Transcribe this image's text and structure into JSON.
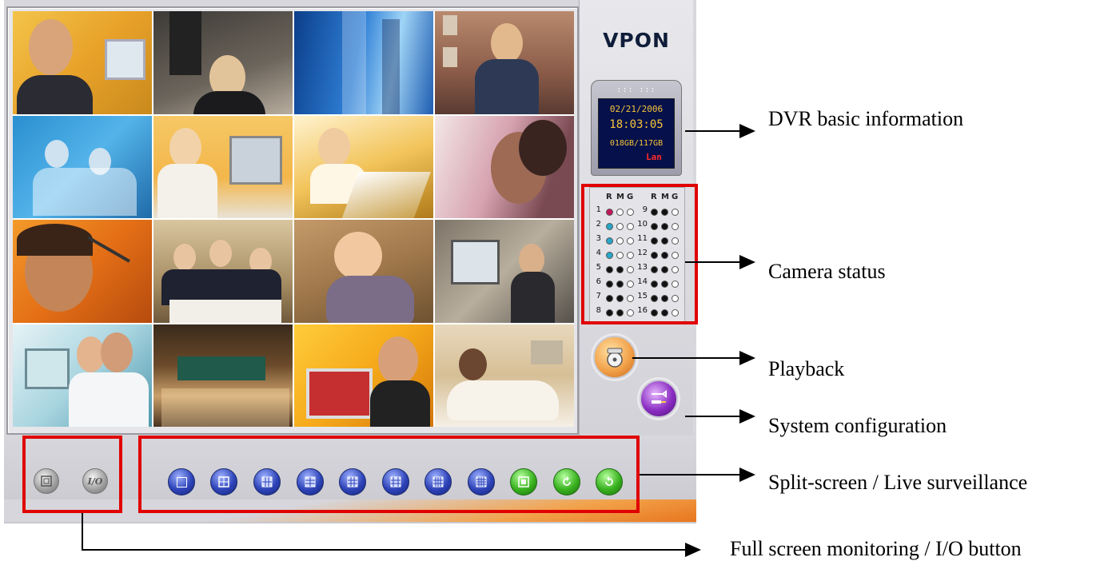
{
  "brand": {
    "logo": "VPON"
  },
  "dvr_info": {
    "top_dots": "::: :::",
    "date": "02/21/2006",
    "time": "18:03:05",
    "storage": "018GB/117GB",
    "connection": "Lan"
  },
  "camera_status": {
    "headers": [
      "R",
      "M",
      "G",
      "R",
      "M",
      "G"
    ],
    "left_numbers": [
      "1",
      "2",
      "3",
      "4",
      "5",
      "6",
      "7",
      "8"
    ],
    "right_numbers": [
      "9",
      "10",
      "11",
      "12",
      "13",
      "14",
      "15",
      "16"
    ]
  },
  "buttons": {
    "fullscreen_icon": "fullscreen-icon",
    "io_label": "I/O"
  },
  "annotations": {
    "dvr_info": "DVR basic information",
    "camera_status": "Camera status",
    "playback": "Playback",
    "system_config": "System configuration",
    "split_screen": "Split-screen / Live surveillance",
    "fullscreen_io": "Full screen monitoring / I/O button"
  },
  "colors": {
    "highlight_red": "#e00000",
    "split_blue": "#2e44b8",
    "live_green": "#39b21f",
    "playback_orange": "#f2a24a",
    "config_purple": "#8a2cc2"
  }
}
